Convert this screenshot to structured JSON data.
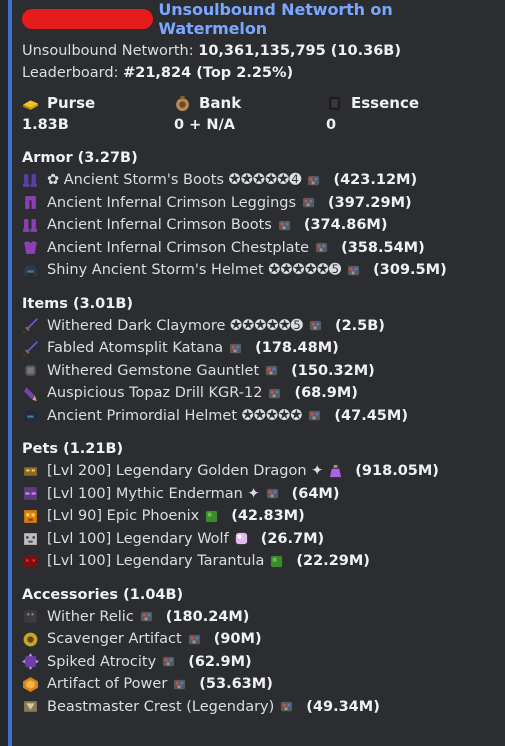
{
  "header": {
    "title": "Unsoulbound Networth on Watermelon"
  },
  "summary": {
    "networth_label": "Unsoulbound Networth:",
    "networth_value": "10,361,135,795 (10.36B)",
    "leaderboard_label": "Leaderboard:",
    "leaderboard_value": "#21,824 (Top 2.25%)"
  },
  "stats": [
    {
      "label": "Purse",
      "value": "1.83B",
      "icon": "gold-ingot-icon",
      "color": "#f2c22d"
    },
    {
      "label": "Bank",
      "value": "0 + N/A",
      "icon": "bank-icon",
      "color": "#b58b52"
    },
    {
      "label": "Essence",
      "value": "0",
      "icon": "essence-icon",
      "color": "#3a3a3a"
    }
  ],
  "sections": [
    {
      "title": "Armor (3.27B)",
      "items": [
        {
          "name": "✿ Ancient Storm's Boots ✪✪✪✪✪➍",
          "value": "(423.12M)",
          "icon": "boots-icon",
          "color": "#5a3fa6"
        },
        {
          "name": "Ancient Infernal Crimson Leggings",
          "value": "(397.29M)",
          "icon": "leggings-icon",
          "color": "#8e3fb8"
        },
        {
          "name": "Ancient Infernal Crimson Boots",
          "value": "(374.86M)",
          "icon": "boots-icon",
          "color": "#8e3fb8"
        },
        {
          "name": "Ancient Infernal Crimson Chestplate",
          "value": "(358.54M)",
          "icon": "chestplate-icon",
          "color": "#8e3fb8"
        },
        {
          "name": "Shiny Ancient Storm's Helmet ✪✪✪✪✪➎",
          "value": "(309.5M)",
          "icon": "helmet-icon",
          "color": "#2f3a48"
        }
      ]
    },
    {
      "title": "Items (3.01B)",
      "items": [
        {
          "name": "Withered Dark Claymore ✪✪✪✪✪➎",
          "value": "(2.5B)",
          "icon": "sword-icon",
          "color": "#7b5be0"
        },
        {
          "name": "Fabled Atomsplit Katana",
          "value": "(178.48M)",
          "icon": "sword-icon",
          "color": "#6f5ee0"
        },
        {
          "name": "Withered Gemstone Gauntlet",
          "value": "(150.32M)",
          "icon": "gauntlet-icon",
          "color": "#555"
        },
        {
          "name": "Auspicious Topaz Drill KGR-12",
          "value": "(68.9M)",
          "icon": "drill-icon",
          "color": "#7b3fb5"
        },
        {
          "name": "Ancient Primordial Helmet ✪✪✪✪✪",
          "value": "(47.45M)",
          "icon": "helmet-icon",
          "color": "#1f2a40"
        }
      ]
    },
    {
      "title": "Pets (1.21B)",
      "items": [
        {
          "name": "[Lvl 200] Legendary Golden Dragon ✦",
          "value": "(918.05M)",
          "icon": "golden-dragon-icon",
          "color": "#8a6a2a",
          "extra": "potion-icon"
        },
        {
          "name": "[Lvl 100] Mythic Enderman ✦",
          "value": "(64M)",
          "icon": "enderman-icon",
          "color": "#5b3d7a"
        },
        {
          "name": "[Lvl 90] Epic Phoenix",
          "value": "(42.83M)",
          "icon": "phoenix-icon",
          "color": "#d67a16",
          "extra": "green-gem-icon"
        },
        {
          "name": "[Lvl 100] Legendary Wolf",
          "value": "(26.7M)",
          "icon": "wolf-icon",
          "color": "#bdbdbd",
          "extra": "pink-gem-icon"
        },
        {
          "name": "[Lvl 100] Legendary Tarantula",
          "value": "(22.29M)",
          "icon": "tarantula-icon",
          "color": "#7a1010",
          "extra": "green-gem-icon"
        }
      ]
    },
    {
      "title": "Accessories (1.04B)",
      "items": [
        {
          "name": "Wither Relic",
          "value": "(180.24M)",
          "icon": "wither-relic-icon",
          "color": "#3b3b3b"
        },
        {
          "name": "Scavenger Artifact",
          "value": "(90M)",
          "icon": "scavenger-icon",
          "color": "#c9a227"
        },
        {
          "name": "Spiked Atrocity",
          "value": "(62.9M)",
          "icon": "spiked-icon",
          "color": "#6a3fa6"
        },
        {
          "name": "Artifact of Power",
          "value": "(53.63M)",
          "icon": "artifact-power-icon",
          "color": "#d9831a"
        },
        {
          "name": "Beastmaster Crest (Legendary)",
          "value": "(49.34M)",
          "icon": "crest-icon",
          "color": "#8a7a5a"
        }
      ]
    }
  ],
  "colors": {
    "accent": "#3e6fd1",
    "title": "#7aa7ff",
    "redaction": "#e61b1b",
    "background": "#2b2d31"
  }
}
